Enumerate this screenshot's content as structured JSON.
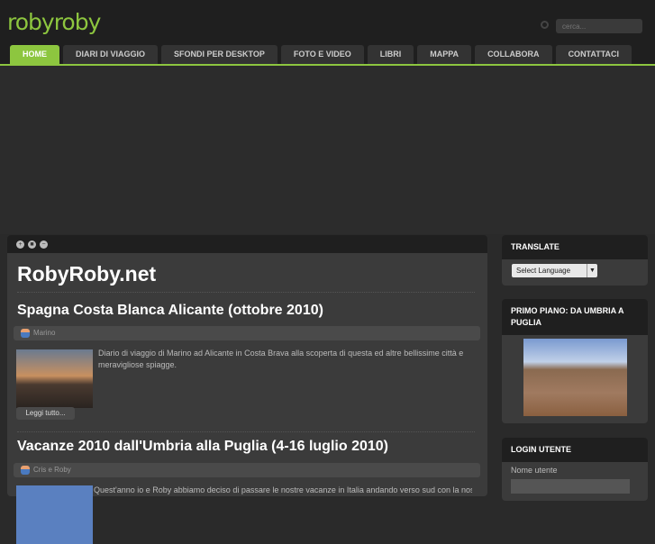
{
  "header": {
    "logo": "robyroby",
    "search_placeholder": "cerca..."
  },
  "nav": [
    "HOME",
    "DIARI DI VIAGGIO",
    "SFONDI PER DESKTOP",
    "FOTO E VIDEO",
    "LIBRI",
    "MAPPA",
    "COLLABORA",
    "CONTATTACI"
  ],
  "main": {
    "site_title": "RobyRoby.net",
    "articles": [
      {
        "title": "Spagna Costa Blanca Alicante (ottobre 2010)",
        "author": "Marino",
        "excerpt": "Diario di viaggio di Marino ad Alicante in Costa Brava alla scoperta di questa ed altre bellissime città e meravigliose spiagge.",
        "more": "Leggi tutto..."
      },
      {
        "title": "Vacanze 2010 dall'Umbria alla Puglia (4-16 luglio 2010)",
        "author": "Cris e Roby",
        "excerpt": "Quest'anno io e Roby abbiamo deciso di passare le nostre vacanze in Italia andando verso sud con la nostra"
      }
    ]
  },
  "sidebar": {
    "translate": {
      "title": "TRANSLATE",
      "select": "Select Language"
    },
    "featured": {
      "title": "PRIMO PIANO: DA UMBRIA A PUGLIA"
    },
    "login": {
      "title": "LOGIN UTENTE",
      "username_label": "Nome utente"
    }
  }
}
